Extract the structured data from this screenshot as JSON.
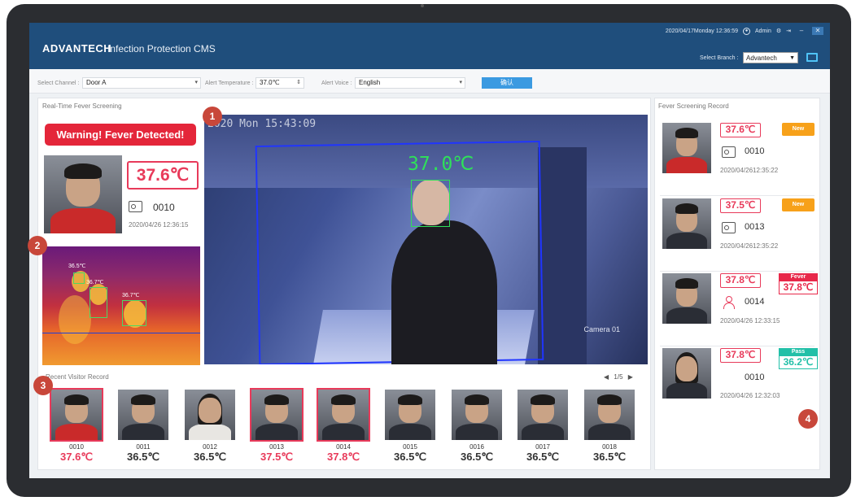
{
  "header": {
    "brand": "ADVANTECH",
    "app_title": "Infection Protection CMS",
    "datetime": "2020/04/17Monday 12:36:59",
    "user": "Admin",
    "branch_label": "Select Branch :",
    "branch_value": "Advantech"
  },
  "controls": {
    "channel_label": "Select Channel :",
    "channel_value": "Door A",
    "temp_label": "Alert Temperature :",
    "temp_value": "37.0℃",
    "voice_label": "Alert Voice :",
    "voice_value": "English",
    "confirm_label": "确认"
  },
  "realtime": {
    "title": "Real-Time Fever Screening",
    "warning": "Warning! Fever Detected!",
    "temperature": "37.6℃",
    "id": "0010",
    "timestamp": "2020/04/26  12:36:15",
    "thermal_labels": [
      "36.5℃",
      "36.7℃",
      "36.7℃"
    ],
    "camera_osd": "2020 Mon 15:43:09",
    "camera_temp": "37.0℃",
    "camera_caption": "Camera 01"
  },
  "visitors": {
    "title": "Recent Visitor Record",
    "page": "1/5",
    "items": [
      {
        "id": "0010",
        "temp": "37.6℃",
        "alert": true
      },
      {
        "id": "0011",
        "temp": "36.5℃",
        "alert": false
      },
      {
        "id": "0012",
        "temp": "36.5℃",
        "alert": false
      },
      {
        "id": "0013",
        "temp": "37.5℃",
        "alert": true
      },
      {
        "id": "0014",
        "temp": "37.8℃",
        "alert": true
      },
      {
        "id": "0015",
        "temp": "36.5℃",
        "alert": false
      },
      {
        "id": "0016",
        "temp": "36.5℃",
        "alert": false
      },
      {
        "id": "0017",
        "temp": "36.5℃",
        "alert": false
      },
      {
        "id": "0018",
        "temp": "36.5℃",
        "alert": false
      }
    ]
  },
  "records": {
    "title": "Fever Screening Record",
    "items": [
      {
        "temp": "37.6℃",
        "badge": "New",
        "id": "0010",
        "timestamp": "2020/04/2612:35:22"
      },
      {
        "temp": "37.5℃",
        "badge": "New",
        "id": "0013",
        "timestamp": "2020/04/2612:35:22"
      },
      {
        "temp": "37.8℃",
        "status": "Fever",
        "status_value": "37.8℃",
        "id": "0014",
        "timestamp": "2020/04/26  12:33:15"
      },
      {
        "temp": "37.8℃",
        "status": "Pass",
        "status_value": "36.2℃",
        "id": "0010",
        "timestamp": "2020/04/26  12:32:03"
      }
    ]
  },
  "markers": [
    "1",
    "2",
    "3",
    "4"
  ],
  "colors": {
    "header": "#1f4e7c",
    "alert": "#e83a5a",
    "new": "#f7a11a",
    "pass": "#22c0a8"
  }
}
